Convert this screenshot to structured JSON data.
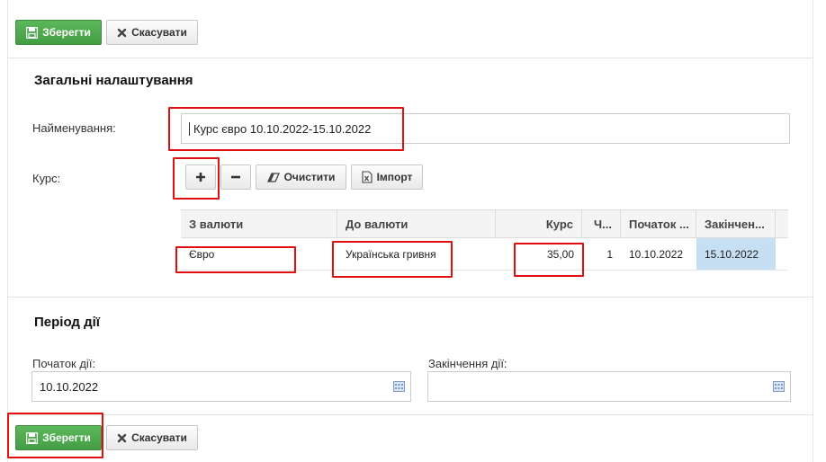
{
  "toolbar_top": {
    "save_label": "Зберегти",
    "cancel_label": "Скасувати"
  },
  "general": {
    "title": "Загальні налаштування",
    "name_label": "Найменування:",
    "name_value": "Курс євро 10.10.2022-15.10.2022",
    "rate_label": "Курс:",
    "clear_label": "Очистити",
    "import_label": "Імпорт"
  },
  "grid": {
    "columns": [
      "З валюти",
      "До валюти",
      "Курс",
      "Ч...",
      "Початок ...",
      "Закінчен..."
    ],
    "rows": [
      [
        "Євро",
        "Українська гривня",
        "35,00",
        "1",
        "10.10.2022",
        "15.10.2022"
      ]
    ]
  },
  "period": {
    "title": "Період дії",
    "start_label": "Початок дії:",
    "start_value": "10.10.2022",
    "end_label": "Закінчення дії:",
    "end_value": ""
  },
  "toolbar_bottom": {
    "save_label": "Зберегти",
    "cancel_label": "Скасувати"
  },
  "colors": {
    "accent_green": "#4cae4c",
    "highlight_red": "#e01010",
    "selected_cell": "#c6dff3"
  }
}
